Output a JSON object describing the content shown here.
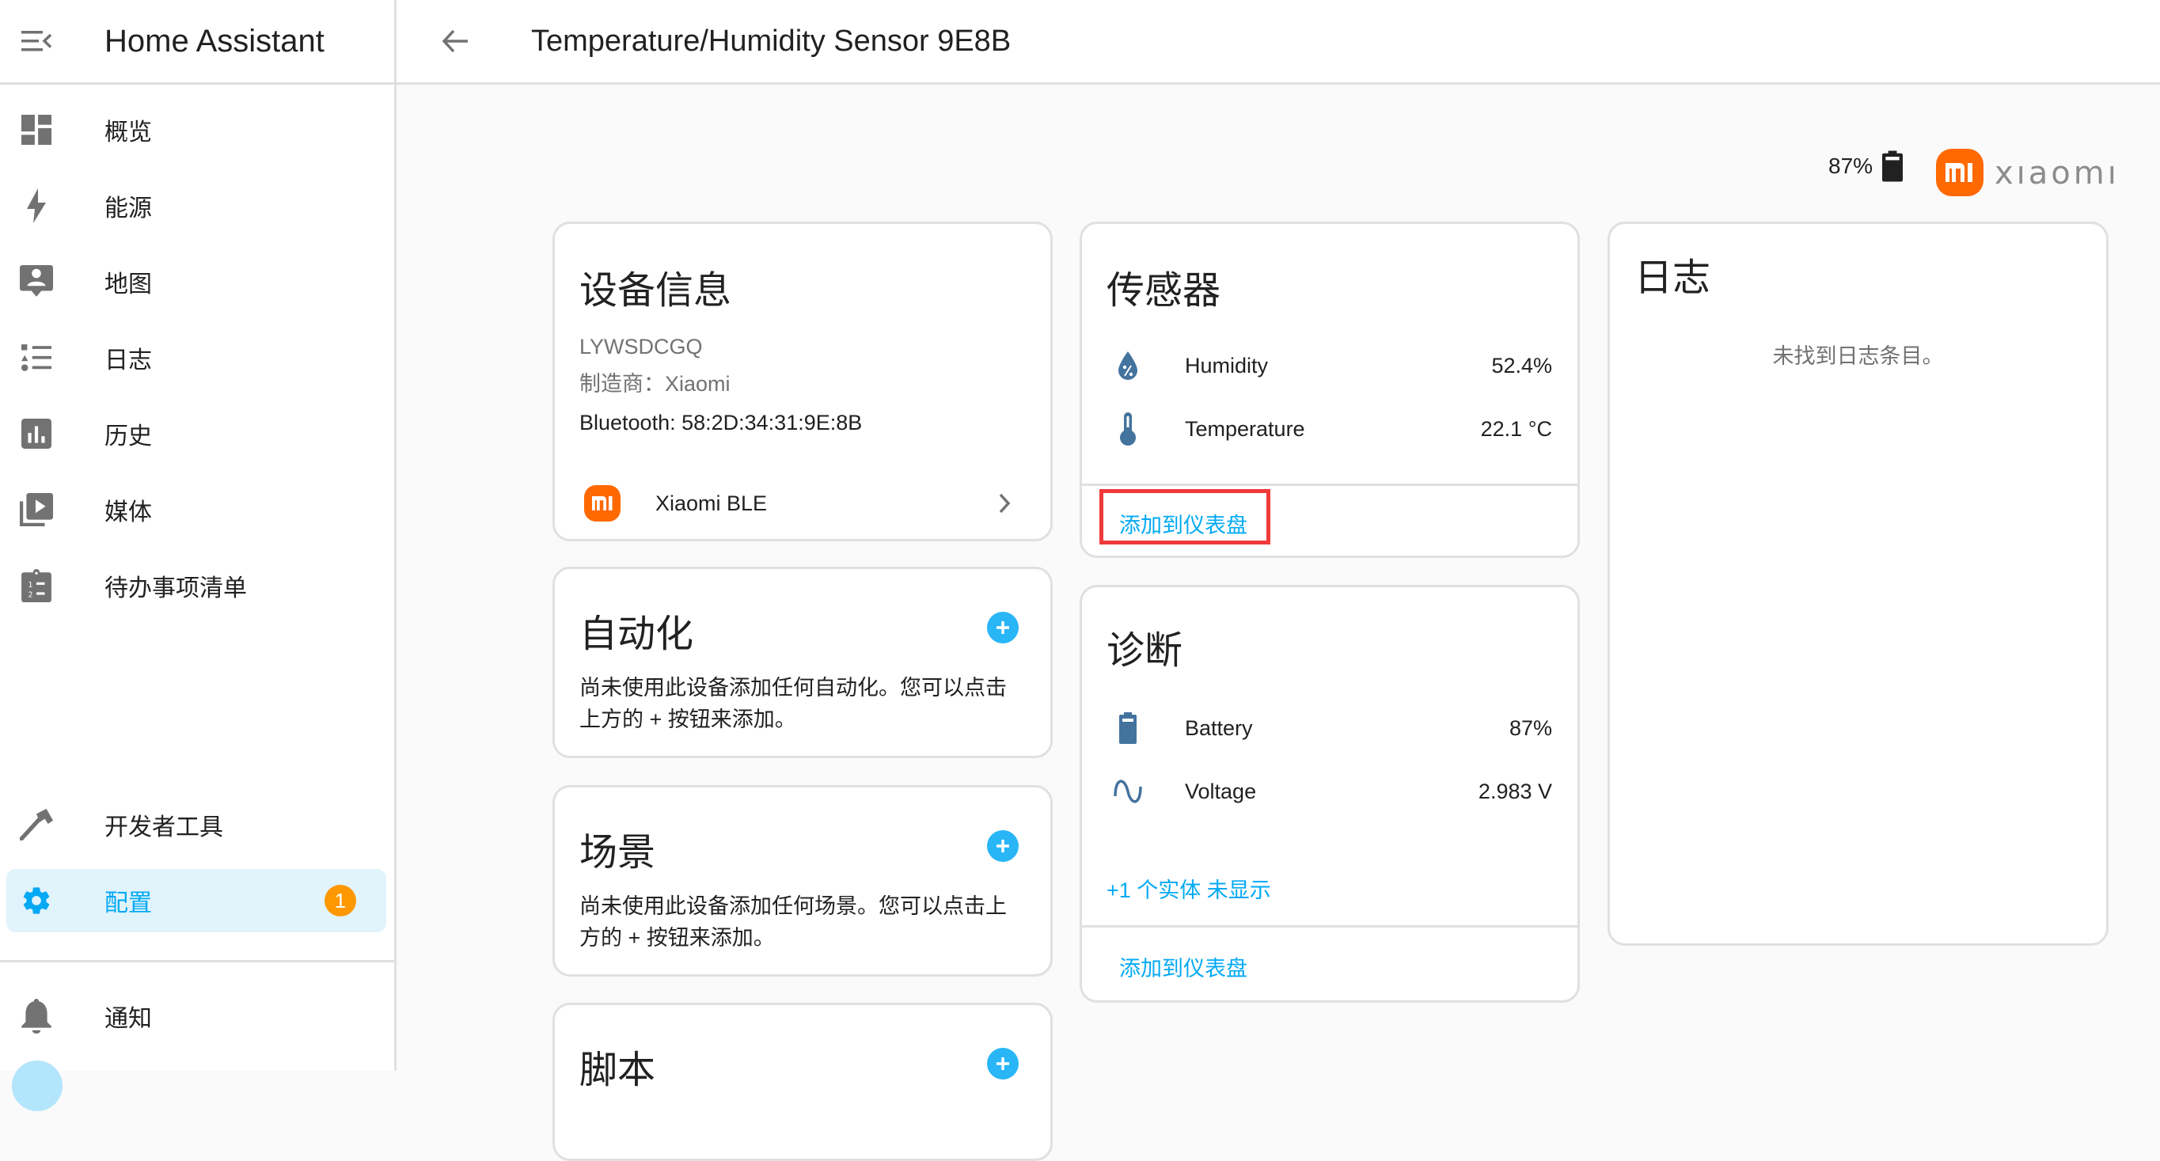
{
  "app": {
    "title": "Home Assistant"
  },
  "sidebar": {
    "items": [
      {
        "label": "概览",
        "icon": "dashboard-icon"
      },
      {
        "label": "能源",
        "icon": "lightning-icon"
      },
      {
        "label": "地图",
        "icon": "map-account-icon"
      },
      {
        "label": "日志",
        "icon": "logbook-icon"
      },
      {
        "label": "历史",
        "icon": "history-chart-icon"
      },
      {
        "label": "媒体",
        "icon": "media-play-icon"
      },
      {
        "label": "待办事项清单",
        "icon": "todo-clipboard-icon"
      },
      {
        "label": "开发者工具",
        "icon": "hammer-icon"
      },
      {
        "label": "配置",
        "icon": "gear-icon",
        "badge": "1",
        "active": true
      },
      {
        "label": "通知",
        "icon": "bell-icon"
      }
    ]
  },
  "header": {
    "title": "Temperature/Humidity Sensor 9E8B"
  },
  "device_status": {
    "battery": "87%",
    "brand_word": "xıaomı"
  },
  "device_info": {
    "title": "设备信息",
    "model": "LYWSDCGQ",
    "manufacturer": "制造商：Xiaomi",
    "connection": "Bluetooth: 58:2D:34:31:9E:8B",
    "integration": "Xiaomi BLE"
  },
  "automation": {
    "title": "自动化",
    "text_line1": "尚未使用此设备添加任何自动化。您可以点击",
    "text_line2": "上方的 + 按钮来添加。"
  },
  "scene": {
    "title": "场景",
    "text_line1": "尚未使用此设备添加任何场景。您可以点击上",
    "text_line2": "方的 + 按钮来添加。"
  },
  "script": {
    "title": "脚本"
  },
  "sensors": {
    "title": "传感器",
    "rows": [
      {
        "name": "Humidity",
        "value": "52.4%",
        "icon": "humidity-percent-icon"
      },
      {
        "name": "Temperature",
        "value": "22.1 °C",
        "icon": "thermometer-icon"
      }
    ],
    "add_to_dashboard": "添加到仪表盘"
  },
  "diagnostics": {
    "title": "诊断",
    "rows": [
      {
        "name": "Battery",
        "value": "87%",
        "icon": "battery-icon"
      },
      {
        "name": "Voltage",
        "value": "2.983 V",
        "icon": "sine-wave-icon"
      }
    ],
    "hidden_entities": "+1 个实体 未显示",
    "add_to_dashboard": "添加到仪表盘"
  },
  "logbook": {
    "title": "日志",
    "empty": "未找到日志条目。"
  },
  "colors": {
    "accent": "#03a9f4",
    "badge": "#ff9800",
    "entity_icon": "#44739e",
    "xiaomi": "#ff6900",
    "highlight": "#f03a3a"
  }
}
